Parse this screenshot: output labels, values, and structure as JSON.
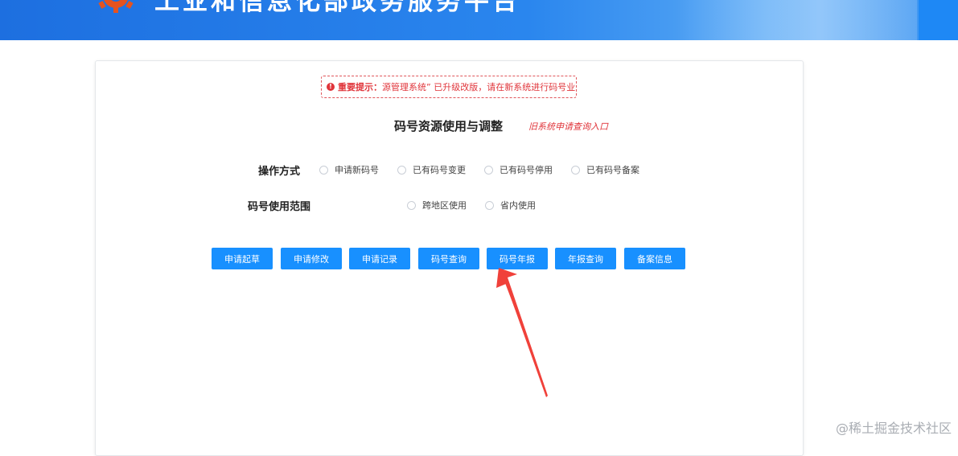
{
  "header": {
    "site_title": "工业和信息化部政务服务平台",
    "logo_icon": "gear-logo-icon",
    "colors": {
      "primary": "#1d6fe0",
      "accent": "#3b93f0"
    }
  },
  "notice": {
    "label": "重要提示：",
    "text": "源管理系统” 已升级改版，请在新系统进行码号业",
    "icon": "warning-circle-icon",
    "color": "#e0353b"
  },
  "page": {
    "title": "码号资源使用与调整",
    "old_system_link": "旧系统申请查询入口"
  },
  "form": {
    "operation": {
      "label": "操作方式",
      "options": [
        "申请新码号",
        "已有码号变更",
        "已有码号停用",
        "已有码号备案"
      ]
    },
    "scope": {
      "label": "码号使用范围",
      "options": [
        "跨地区使用",
        "省内使用"
      ]
    }
  },
  "buttons": [
    "申请起草",
    "申请修改",
    "申请记录",
    "码号查询",
    "码号年报",
    "年报查询",
    "备案信息"
  ],
  "button_color": "#1890ff",
  "watermark": "@稀土掘金技术社区"
}
